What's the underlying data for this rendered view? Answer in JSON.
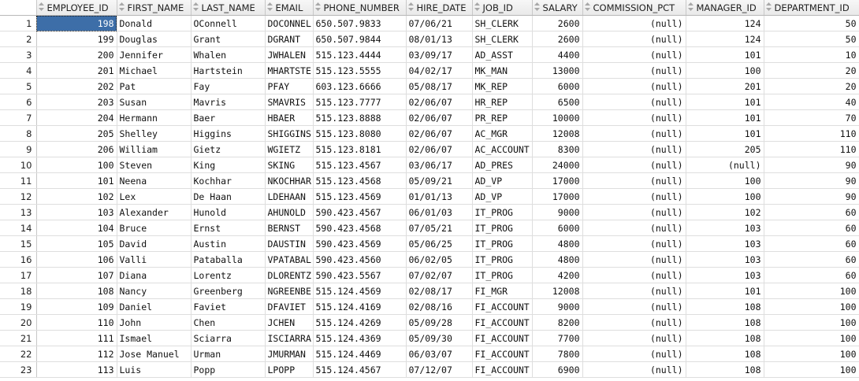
{
  "columns": [
    {
      "key": "EMPLOYEE_ID",
      "label": "EMPLOYEE_ID",
      "align": "right"
    },
    {
      "key": "FIRST_NAME",
      "label": "FIRST_NAME",
      "align": "left"
    },
    {
      "key": "LAST_NAME",
      "label": "LAST_NAME",
      "align": "left"
    },
    {
      "key": "EMAIL",
      "label": "EMAIL",
      "align": "left"
    },
    {
      "key": "PHONE_NUMBER",
      "label": "PHONE_NUMBER",
      "align": "left"
    },
    {
      "key": "HIRE_DATE",
      "label": "HIRE_DATE",
      "align": "left"
    },
    {
      "key": "JOB_ID",
      "label": "JOB_ID",
      "align": "left"
    },
    {
      "key": "SALARY",
      "label": "SALARY",
      "align": "right"
    },
    {
      "key": "COMMISSION_PCT",
      "label": "COMMISSION_PCT",
      "align": "right"
    },
    {
      "key": "MANAGER_ID",
      "label": "MANAGER_ID",
      "align": "right"
    },
    {
      "key": "DEPARTMENT_ID",
      "label": "DEPARTMENT_ID",
      "align": "right"
    }
  ],
  "sort_icon": "sort-arrows-icon",
  "selected_cell": {
    "row": 0,
    "column": "EMPLOYEE_ID"
  },
  "colors": {
    "selection": "#3d6ea8"
  },
  "rows": [
    {
      "n": "1",
      "cells": [
        "198",
        "Donald",
        "OConnell",
        "DOCONNEL",
        "650.507.9833",
        "07/06/21",
        "SH_CLERK",
        "2600",
        "(null)",
        "124",
        "50"
      ]
    },
    {
      "n": "2",
      "cells": [
        "199",
        "Douglas",
        "Grant",
        "DGRANT",
        "650.507.9844",
        "08/01/13",
        "SH_CLERK",
        "2600",
        "(null)",
        "124",
        "50"
      ]
    },
    {
      "n": "3",
      "cells": [
        "200",
        "Jennifer",
        "Whalen",
        "JWHALEN",
        "515.123.4444",
        "03/09/17",
        "AD_ASST",
        "4400",
        "(null)",
        "101",
        "10"
      ]
    },
    {
      "n": "4",
      "cells": [
        "201",
        "Michael",
        "Hartstein",
        "MHARTSTE",
        "515.123.5555",
        "04/02/17",
        "MK_MAN",
        "13000",
        "(null)",
        "100",
        "20"
      ]
    },
    {
      "n": "5",
      "cells": [
        "202",
        "Pat",
        "Fay",
        "PFAY",
        "603.123.6666",
        "05/08/17",
        "MK_REP",
        "6000",
        "(null)",
        "201",
        "20"
      ]
    },
    {
      "n": "6",
      "cells": [
        "203",
        "Susan",
        "Mavris",
        "SMAVRIS",
        "515.123.7777",
        "02/06/07",
        "HR_REP",
        "6500",
        "(null)",
        "101",
        "40"
      ]
    },
    {
      "n": "7",
      "cells": [
        "204",
        "Hermann",
        "Baer",
        "HBAER",
        "515.123.8888",
        "02/06/07",
        "PR_REP",
        "10000",
        "(null)",
        "101",
        "70"
      ]
    },
    {
      "n": "8",
      "cells": [
        "205",
        "Shelley",
        "Higgins",
        "SHIGGINS",
        "515.123.8080",
        "02/06/07",
        "AC_MGR",
        "12008",
        "(null)",
        "101",
        "110"
      ]
    },
    {
      "n": "9",
      "cells": [
        "206",
        "William",
        "Gietz",
        "WGIETZ",
        "515.123.8181",
        "02/06/07",
        "AC_ACCOUNT",
        "8300",
        "(null)",
        "205",
        "110"
      ]
    },
    {
      "n": "10",
      "cells": [
        "100",
        "Steven",
        "King",
        "SKING",
        "515.123.4567",
        "03/06/17",
        "AD_PRES",
        "24000",
        "(null)",
        "(null)",
        "90"
      ]
    },
    {
      "n": "11",
      "cells": [
        "101",
        "Neena",
        "Kochhar",
        "NKOCHHAR",
        "515.123.4568",
        "05/09/21",
        "AD_VP",
        "17000",
        "(null)",
        "100",
        "90"
      ]
    },
    {
      "n": "12",
      "cells": [
        "102",
        "Lex",
        "De Haan",
        "LDEHAAN",
        "515.123.4569",
        "01/01/13",
        "AD_VP",
        "17000",
        "(null)",
        "100",
        "90"
      ]
    },
    {
      "n": "13",
      "cells": [
        "103",
        "Alexander",
        "Hunold",
        "AHUNOLD",
        "590.423.4567",
        "06/01/03",
        "IT_PROG",
        "9000",
        "(null)",
        "102",
        "60"
      ]
    },
    {
      "n": "14",
      "cells": [
        "104",
        "Bruce",
        "Ernst",
        "BERNST",
        "590.423.4568",
        "07/05/21",
        "IT_PROG",
        "6000",
        "(null)",
        "103",
        "60"
      ]
    },
    {
      "n": "15",
      "cells": [
        "105",
        "David",
        "Austin",
        "DAUSTIN",
        "590.423.4569",
        "05/06/25",
        "IT_PROG",
        "4800",
        "(null)",
        "103",
        "60"
      ]
    },
    {
      "n": "16",
      "cells": [
        "106",
        "Valli",
        "Pataballa",
        "VPATABAL",
        "590.423.4560",
        "06/02/05",
        "IT_PROG",
        "4800",
        "(null)",
        "103",
        "60"
      ]
    },
    {
      "n": "17",
      "cells": [
        "107",
        "Diana",
        "Lorentz",
        "DLORENTZ",
        "590.423.5567",
        "07/02/07",
        "IT_PROG",
        "4200",
        "(null)",
        "103",
        "60"
      ]
    },
    {
      "n": "18",
      "cells": [
        "108",
        "Nancy",
        "Greenberg",
        "NGREENBE",
        "515.124.4569",
        "02/08/17",
        "FI_MGR",
        "12008",
        "(null)",
        "101",
        "100"
      ]
    },
    {
      "n": "19",
      "cells": [
        "109",
        "Daniel",
        "Faviet",
        "DFAVIET",
        "515.124.4169",
        "02/08/16",
        "FI_ACCOUNT",
        "9000",
        "(null)",
        "108",
        "100"
      ]
    },
    {
      "n": "20",
      "cells": [
        "110",
        "John",
        "Chen",
        "JCHEN",
        "515.124.4269",
        "05/09/28",
        "FI_ACCOUNT",
        "8200",
        "(null)",
        "108",
        "100"
      ]
    },
    {
      "n": "21",
      "cells": [
        "111",
        "Ismael",
        "Sciarra",
        "ISCIARRA",
        "515.124.4369",
        "05/09/30",
        "FI_ACCOUNT",
        "7700",
        "(null)",
        "108",
        "100"
      ]
    },
    {
      "n": "22",
      "cells": [
        "112",
        "Jose Manuel",
        "Urman",
        "JMURMAN",
        "515.124.4469",
        "06/03/07",
        "FI_ACCOUNT",
        "7800",
        "(null)",
        "108",
        "100"
      ]
    },
    {
      "n": "23",
      "cells": [
        "113",
        "Luis",
        "Popp",
        "LPOPP",
        "515.124.4567",
        "07/12/07",
        "FI_ACCOUNT",
        "6900",
        "(null)",
        "108",
        "100"
      ]
    }
  ]
}
